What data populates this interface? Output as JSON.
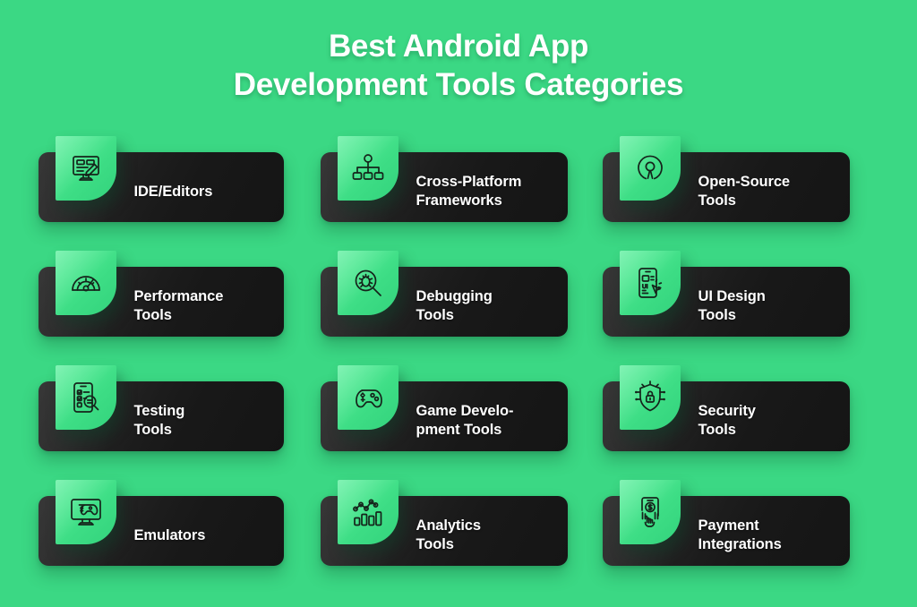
{
  "background_color": "#3bd884",
  "card_color": "#1c1c1c",
  "tile_color": "#40e08a",
  "title": {
    "line1": "Best Android App",
    "line2": "Development Tools Categories",
    "color": "#ffffff"
  },
  "cards": [
    {
      "icon": "monitor-pencil-icon",
      "line1": "IDE/Editors",
      "line2": ""
    },
    {
      "icon": "sitemap-hierarchy-icon",
      "line1": "Cross-Platform",
      "line2": "Frameworks"
    },
    {
      "icon": "open-source-logo-icon",
      "line1": "Open-Source",
      "line2": "Tools"
    },
    {
      "icon": "speedometer-gauge-icon",
      "line1": "Performance",
      "line2": "Tools"
    },
    {
      "icon": "magnifier-bug-icon",
      "line1": "Debugging",
      "line2": "Tools"
    },
    {
      "icon": "phone-ui-cursor-icon",
      "line1": "UI Design",
      "line2": "Tools"
    },
    {
      "icon": "phone-checklist-magnifier-icon",
      "line1": "Testing",
      "line2": "Tools"
    },
    {
      "icon": "gamepad-icon",
      "line1": "Game Develo-",
      "line2": "pment Tools"
    },
    {
      "icon": "shield-lock-circuit-icon",
      "line1": "Security",
      "line2": "Tools"
    },
    {
      "icon": "monitor-gamepad-icon",
      "line1": "Emulators",
      "line2": ""
    },
    {
      "icon": "bar-chart-line-icon",
      "line1": "Analytics",
      "line2": "Tools"
    },
    {
      "icon": "phone-hand-dollar-icon",
      "line1": "Payment",
      "line2": "Integrations"
    }
  ]
}
